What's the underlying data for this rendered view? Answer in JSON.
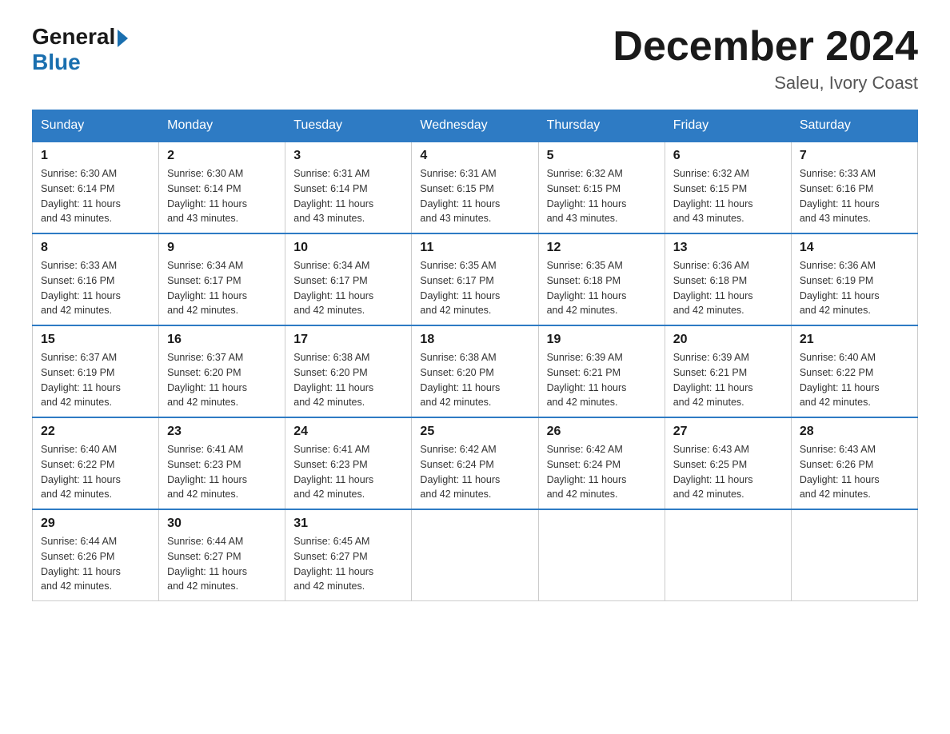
{
  "logo": {
    "text_general": "General",
    "text_blue": "Blue",
    "icon": "▶"
  },
  "header": {
    "title": "December 2024",
    "subtitle": "Saleu, Ivory Coast"
  },
  "weekdays": [
    "Sunday",
    "Monday",
    "Tuesday",
    "Wednesday",
    "Thursday",
    "Friday",
    "Saturday"
  ],
  "weeks": [
    [
      {
        "day": "1",
        "sunrise": "Sunrise: 6:30 AM",
        "sunset": "Sunset: 6:14 PM",
        "daylight": "Daylight: 11 hours and 43 minutes."
      },
      {
        "day": "2",
        "sunrise": "Sunrise: 6:30 AM",
        "sunset": "Sunset: 6:14 PM",
        "daylight": "Daylight: 11 hours and 43 minutes."
      },
      {
        "day": "3",
        "sunrise": "Sunrise: 6:31 AM",
        "sunset": "Sunset: 6:14 PM",
        "daylight": "Daylight: 11 hours and 43 minutes."
      },
      {
        "day": "4",
        "sunrise": "Sunrise: 6:31 AM",
        "sunset": "Sunset: 6:15 PM",
        "daylight": "Daylight: 11 hours and 43 minutes."
      },
      {
        "day": "5",
        "sunrise": "Sunrise: 6:32 AM",
        "sunset": "Sunset: 6:15 PM",
        "daylight": "Daylight: 11 hours and 43 minutes."
      },
      {
        "day": "6",
        "sunrise": "Sunrise: 6:32 AM",
        "sunset": "Sunset: 6:15 PM",
        "daylight": "Daylight: 11 hours and 43 minutes."
      },
      {
        "day": "7",
        "sunrise": "Sunrise: 6:33 AM",
        "sunset": "Sunset: 6:16 PM",
        "daylight": "Daylight: 11 hours and 43 minutes."
      }
    ],
    [
      {
        "day": "8",
        "sunrise": "Sunrise: 6:33 AM",
        "sunset": "Sunset: 6:16 PM",
        "daylight": "Daylight: 11 hours and 42 minutes."
      },
      {
        "day": "9",
        "sunrise": "Sunrise: 6:34 AM",
        "sunset": "Sunset: 6:17 PM",
        "daylight": "Daylight: 11 hours and 42 minutes."
      },
      {
        "day": "10",
        "sunrise": "Sunrise: 6:34 AM",
        "sunset": "Sunset: 6:17 PM",
        "daylight": "Daylight: 11 hours and 42 minutes."
      },
      {
        "day": "11",
        "sunrise": "Sunrise: 6:35 AM",
        "sunset": "Sunset: 6:17 PM",
        "daylight": "Daylight: 11 hours and 42 minutes."
      },
      {
        "day": "12",
        "sunrise": "Sunrise: 6:35 AM",
        "sunset": "Sunset: 6:18 PM",
        "daylight": "Daylight: 11 hours and 42 minutes."
      },
      {
        "day": "13",
        "sunrise": "Sunrise: 6:36 AM",
        "sunset": "Sunset: 6:18 PM",
        "daylight": "Daylight: 11 hours and 42 minutes."
      },
      {
        "day": "14",
        "sunrise": "Sunrise: 6:36 AM",
        "sunset": "Sunset: 6:19 PM",
        "daylight": "Daylight: 11 hours and 42 minutes."
      }
    ],
    [
      {
        "day": "15",
        "sunrise": "Sunrise: 6:37 AM",
        "sunset": "Sunset: 6:19 PM",
        "daylight": "Daylight: 11 hours and 42 minutes."
      },
      {
        "day": "16",
        "sunrise": "Sunrise: 6:37 AM",
        "sunset": "Sunset: 6:20 PM",
        "daylight": "Daylight: 11 hours and 42 minutes."
      },
      {
        "day": "17",
        "sunrise": "Sunrise: 6:38 AM",
        "sunset": "Sunset: 6:20 PM",
        "daylight": "Daylight: 11 hours and 42 minutes."
      },
      {
        "day": "18",
        "sunrise": "Sunrise: 6:38 AM",
        "sunset": "Sunset: 6:20 PM",
        "daylight": "Daylight: 11 hours and 42 minutes."
      },
      {
        "day": "19",
        "sunrise": "Sunrise: 6:39 AM",
        "sunset": "Sunset: 6:21 PM",
        "daylight": "Daylight: 11 hours and 42 minutes."
      },
      {
        "day": "20",
        "sunrise": "Sunrise: 6:39 AM",
        "sunset": "Sunset: 6:21 PM",
        "daylight": "Daylight: 11 hours and 42 minutes."
      },
      {
        "day": "21",
        "sunrise": "Sunrise: 6:40 AM",
        "sunset": "Sunset: 6:22 PM",
        "daylight": "Daylight: 11 hours and 42 minutes."
      }
    ],
    [
      {
        "day": "22",
        "sunrise": "Sunrise: 6:40 AM",
        "sunset": "Sunset: 6:22 PM",
        "daylight": "Daylight: 11 hours and 42 minutes."
      },
      {
        "day": "23",
        "sunrise": "Sunrise: 6:41 AM",
        "sunset": "Sunset: 6:23 PM",
        "daylight": "Daylight: 11 hours and 42 minutes."
      },
      {
        "day": "24",
        "sunrise": "Sunrise: 6:41 AM",
        "sunset": "Sunset: 6:23 PM",
        "daylight": "Daylight: 11 hours and 42 minutes."
      },
      {
        "day": "25",
        "sunrise": "Sunrise: 6:42 AM",
        "sunset": "Sunset: 6:24 PM",
        "daylight": "Daylight: 11 hours and 42 minutes."
      },
      {
        "day": "26",
        "sunrise": "Sunrise: 6:42 AM",
        "sunset": "Sunset: 6:24 PM",
        "daylight": "Daylight: 11 hours and 42 minutes."
      },
      {
        "day": "27",
        "sunrise": "Sunrise: 6:43 AM",
        "sunset": "Sunset: 6:25 PM",
        "daylight": "Daylight: 11 hours and 42 minutes."
      },
      {
        "day": "28",
        "sunrise": "Sunrise: 6:43 AM",
        "sunset": "Sunset: 6:26 PM",
        "daylight": "Daylight: 11 hours and 42 minutes."
      }
    ],
    [
      {
        "day": "29",
        "sunrise": "Sunrise: 6:44 AM",
        "sunset": "Sunset: 6:26 PM",
        "daylight": "Daylight: 11 hours and 42 minutes."
      },
      {
        "day": "30",
        "sunrise": "Sunrise: 6:44 AM",
        "sunset": "Sunset: 6:27 PM",
        "daylight": "Daylight: 11 hours and 42 minutes."
      },
      {
        "day": "31",
        "sunrise": "Sunrise: 6:45 AM",
        "sunset": "Sunset: 6:27 PM",
        "daylight": "Daylight: 11 hours and 42 minutes."
      },
      null,
      null,
      null,
      null
    ]
  ]
}
